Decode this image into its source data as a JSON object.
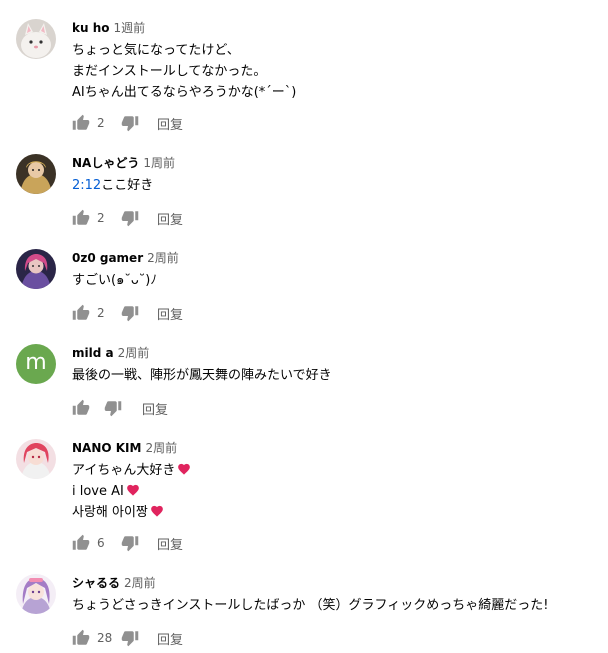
{
  "colors": {
    "link": "#065fd4",
    "heart": "#e0245e",
    "icon": "#909090"
  },
  "comments": [
    {
      "author": "ku ho",
      "time": "1週前",
      "lines": [
        "ちょっと気になってたけど、",
        "まだインストールしてなかった。",
        "AIちゃん出てるならやろうかな(*´ー`)"
      ],
      "likes": "2",
      "reply": "回复",
      "avatar": "white-cat-avatar"
    },
    {
      "author": "NAしゃどう",
      "time": "1周前",
      "timestamp_link": "2:12",
      "lines": [
        "ここ好き"
      ],
      "likes": "2",
      "reply": "回复",
      "avatar": "anime-character-avatar"
    },
    {
      "author": "0z0 gamer",
      "time": "2周前",
      "lines": [
        "すごい(๑˘ᴗ˘)ﾉ"
      ],
      "likes": "2",
      "reply": "回复",
      "avatar": "pink-hair-character-avatar"
    },
    {
      "author": "mild a",
      "time": "2周前",
      "lines": [
        "最後の一戦、陣形が鳳天舞の陣みたいで好き"
      ],
      "likes": "",
      "reply": "回复",
      "avatar": "letter-avatar",
      "avatar_letter": "m"
    },
    {
      "author": "NANO KIM",
      "time": "2周前",
      "lines": [
        "アイちゃん大好き",
        "i love AI",
        "사랑해 아이짱"
      ],
      "likes": "6",
      "reply": "回复",
      "avatar": "red-hair-character-avatar"
    },
    {
      "author": "シャるる",
      "time": "2周前",
      "lines": [
        "ちょうどさっきインストールしたばっか （笑）グラフィックめっちゃ綺麗だった!"
      ],
      "likes": "28",
      "reply": "回复",
      "avatar": "purple-hair-character-avatar"
    }
  ]
}
